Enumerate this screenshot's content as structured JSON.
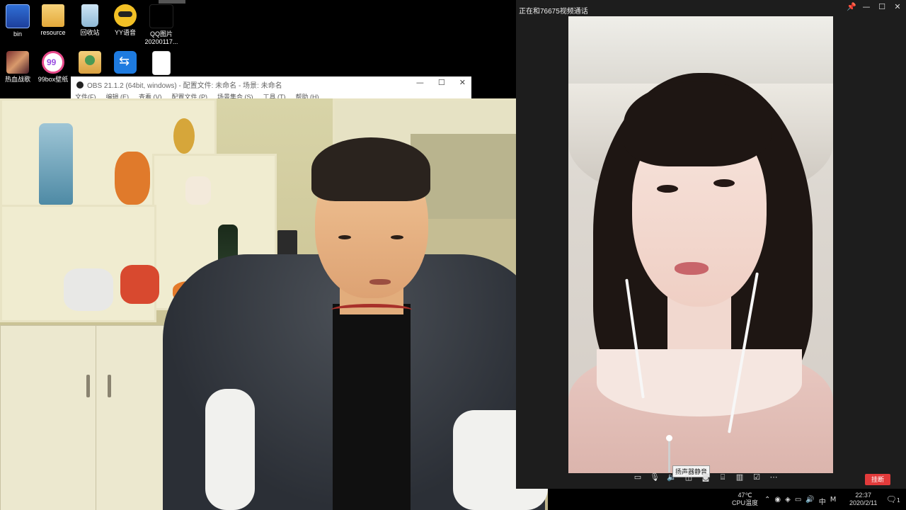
{
  "desktop": {
    "icons": [
      {
        "label": "bin",
        "icon": "bin-icon"
      },
      {
        "label": "resource",
        "icon": "folder-icon"
      },
      {
        "label": "回收站",
        "icon": "recycle-bin-icon"
      },
      {
        "label": "YY语音",
        "icon": "yy-voice-icon"
      },
      {
        "label": "QQ图片\n20200117...",
        "icon": "image-file-icon"
      },
      {
        "label": "热血战歌",
        "icon": "game-icon"
      },
      {
        "label": "99box壁纸",
        "icon": "99box-icon"
      },
      {
        "label": "",
        "icon": "user-folder-icon"
      },
      {
        "label": "",
        "icon": "teamviewer-icon"
      },
      {
        "label": "",
        "icon": "document-icon"
      }
    ]
  },
  "obs": {
    "title": "OBS 21.1.2 (64bit, windows) - 配置文件: 未命名 - 场景: 未命名",
    "menu": [
      "文件(F)",
      "编辑 (E)",
      "查看 (V)",
      "配置文件 (P)",
      "场景集合 (S)",
      "工具 (T)",
      "帮助 (H)"
    ],
    "controls": {
      "minimize": "—",
      "maximize": "☐",
      "close": "✕"
    }
  },
  "call": {
    "title": "正在和76675视频通话",
    "controls": {
      "pin": "📌",
      "minimize": "—",
      "maximize": "☐",
      "close": "✕"
    },
    "toolbar_icons": [
      "chat-icon",
      "microphone-icon",
      "speaker-icon",
      "screen-icon",
      "camera-icon",
      "record-icon",
      "layout-icon",
      "edit-icon",
      "more-icon"
    ],
    "tooltip": "扬声器静音",
    "hangup_label": "挂断"
  },
  "tray": {
    "temp_value": "47℃",
    "temp_label": "CPU温度",
    "ime": "中",
    "time": "22:37",
    "date": "2020/2/11",
    "notifications": "1"
  },
  "colors": {
    "hangup": "#e23b3b",
    "desktop": "#000000"
  }
}
